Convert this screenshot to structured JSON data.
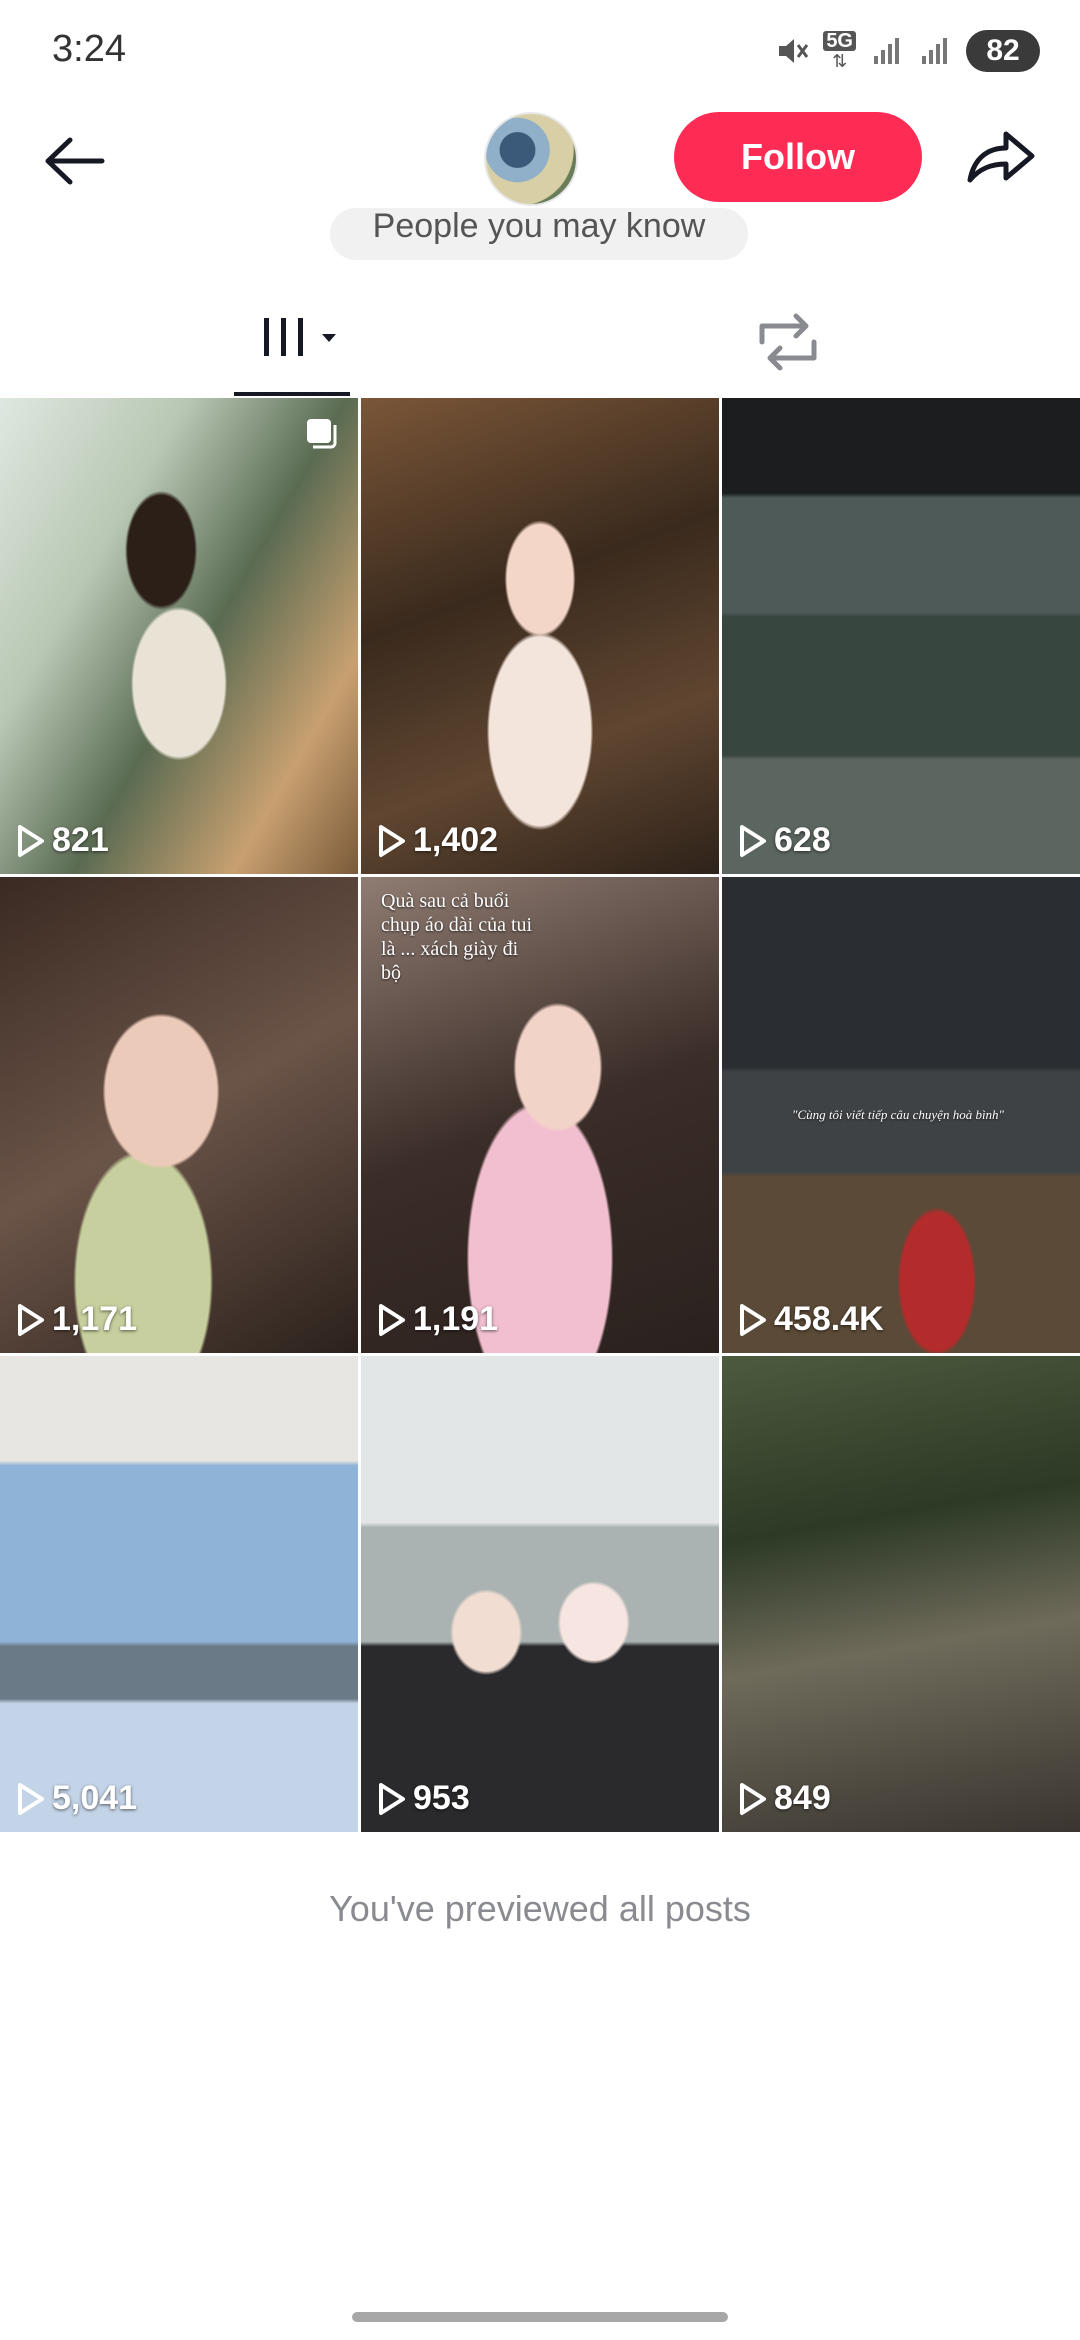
{
  "status_bar": {
    "time": "3:24",
    "network": "5G",
    "battery": "82"
  },
  "header": {
    "follow_label": "Follow",
    "people_you_may_know": "People you may know"
  },
  "tabs": {
    "videos_icon": "videos-grid-icon",
    "reposts_icon": "repost-icon"
  },
  "posts": [
    {
      "views": "821",
      "multi": true,
      "overlay": ""
    },
    {
      "views": "1,402",
      "multi": false,
      "overlay": ""
    },
    {
      "views": "628",
      "multi": false,
      "overlay": ""
    },
    {
      "views": "1,171",
      "multi": false,
      "overlay": ""
    },
    {
      "views": "1,191",
      "multi": false,
      "overlay": "Quà sau cả buổi chụp áo dài của tui là ... xách giày đi bộ"
    },
    {
      "views": "458.4K",
      "multi": false,
      "overlay": "\"Cùng tôi viết tiếp câu chuyện hoà bình\""
    },
    {
      "views": "5,041",
      "multi": false,
      "overlay": ""
    },
    {
      "views": "953",
      "multi": false,
      "overlay": ""
    },
    {
      "views": "849",
      "multi": false,
      "overlay": ""
    }
  ],
  "footer": {
    "previewed_text": "You've previewed all posts"
  },
  "colors": {
    "follow": "#fe2c55",
    "text": "#161823",
    "muted": "#8a8b91"
  }
}
